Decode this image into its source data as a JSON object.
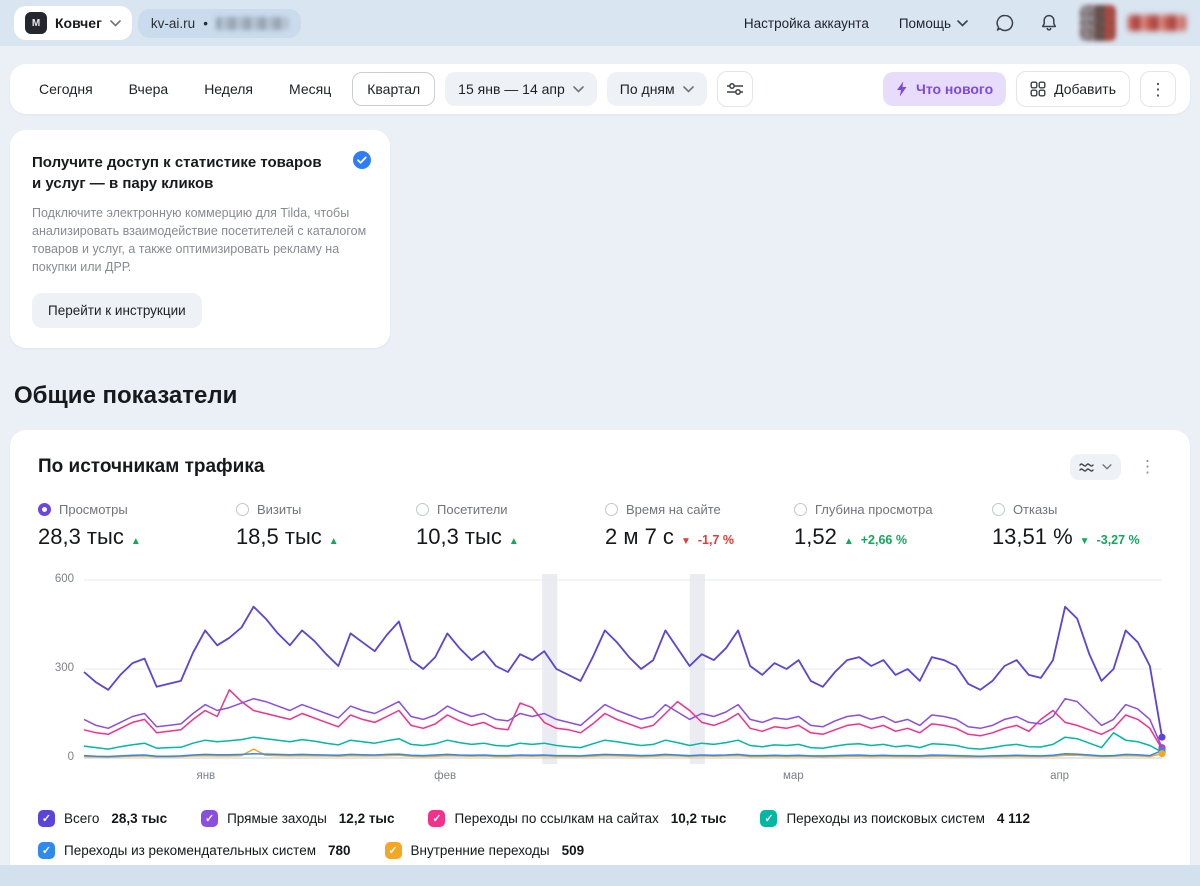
{
  "topbar": {
    "counter_name": "Ковчег",
    "site_domain": "kv-ai.ru",
    "separator": "•",
    "account_settings_label": "Настройка аккаунта",
    "help_label": "Помощь"
  },
  "toolbar": {
    "periods": [
      "Сегодня",
      "Вчера",
      "Неделя",
      "Месяц",
      "Квартал"
    ],
    "selected_period": "Квартал",
    "date_range_label": "15 янв — 14 апр",
    "granularity_label": "По дням",
    "whats_new_label": "Что нового",
    "add_label": "Добавить"
  },
  "promo": {
    "title": "Получите доступ к статистике товаров и услуг — в пару кликов",
    "body": "Подключите электронную коммерцию для Tilda, чтобы анализировать взаимодействие посетителей с каталогом товаров и услуг, а также оптимизировать рекламу на покупки или ДРР.",
    "button_label": "Перейти к инструкции"
  },
  "section_title": "Общие показатели",
  "chart_card": {
    "title": "По источникам трафика",
    "metrics": [
      {
        "label": "Просмотры",
        "value": "28,3 тыс",
        "arrow": "up",
        "arrow_color": "#14a75d",
        "delta": "",
        "delta_color": "",
        "selected": true
      },
      {
        "label": "Визиты",
        "value": "18,5 тыс",
        "arrow": "up",
        "arrow_color": "#14a75d",
        "delta": "",
        "delta_color": "",
        "selected": false
      },
      {
        "label": "Посетители",
        "value": "10,3 тыс",
        "arrow": "up",
        "arrow_color": "#14a75d",
        "delta": "",
        "delta_color": "",
        "selected": false
      },
      {
        "label": "Время на сайте",
        "value": "2 м 7 с",
        "arrow": "down",
        "arrow_color": "#e23b35",
        "delta": "-1,7 %",
        "delta_color": "#e23b35",
        "selected": false
      },
      {
        "label": "Глубина просмотра",
        "value": "1,52",
        "arrow": "up",
        "arrow_color": "#14a75d",
        "delta": "+2,66 %",
        "delta_color": "#14a75d",
        "selected": false
      },
      {
        "label": "Отказы",
        "value": "13,51 %",
        "arrow": "down",
        "arrow_color": "#14a75d",
        "delta": "-3,27 %",
        "delta_color": "#14a75d",
        "selected": false
      }
    ]
  },
  "chart_data": {
    "type": "line",
    "title": "По источникам трафика",
    "ylim": [
      0,
      600
    ],
    "yticks": [
      0,
      300,
      600
    ],
    "grid": true,
    "legend_position": "bottom",
    "xticks": [
      {
        "label": "янв",
        "frac": 0.113
      },
      {
        "label": "фев",
        "frac": 0.335
      },
      {
        "label": "мар",
        "frac": 0.658
      },
      {
        "label": "апр",
        "frac": 0.905
      }
    ],
    "bands": [
      {
        "frac": 0.425,
        "width_frac": 0.014
      },
      {
        "frac": 0.562,
        "width_frac": 0.014
      }
    ],
    "series": [
      {
        "name": "Всего",
        "total": "28,3 тыс",
        "color": "#5b44d8",
        "values": [
          290,
          255,
          230,
          280,
          320,
          335,
          240,
          250,
          260,
          355,
          430,
          380,
          405,
          440,
          510,
          470,
          420,
          380,
          430,
          395,
          350,
          310,
          420,
          390,
          360,
          415,
          460,
          330,
          300,
          340,
          420,
          370,
          330,
          360,
          310,
          290,
          350,
          330,
          360,
          300,
          280,
          260,
          340,
          430,
          390,
          340,
          300,
          330,
          430,
          370,
          310,
          350,
          330,
          370,
          430,
          310,
          280,
          320,
          300,
          330,
          260,
          240,
          290,
          330,
          340,
          310,
          330,
          280,
          300,
          260,
          340,
          330,
          310,
          250,
          230,
          260,
          310,
          330,
          280,
          270,
          330,
          510,
          470,
          350,
          260,
          300,
          430,
          390,
          310,
          70
        ]
      },
      {
        "name": "Прямые заходы",
        "total": "12,2 тыс",
        "color": "#8a4fe0",
        "values": [
          130,
          110,
          100,
          120,
          140,
          150,
          105,
          110,
          115,
          150,
          180,
          160,
          170,
          185,
          200,
          190,
          175,
          160,
          180,
          165,
          150,
          135,
          175,
          160,
          150,
          170,
          190,
          140,
          130,
          145,
          175,
          155,
          140,
          150,
          130,
          125,
          150,
          140,
          150,
          130,
          120,
          110,
          145,
          180,
          160,
          145,
          130,
          140,
          180,
          155,
          130,
          150,
          140,
          155,
          180,
          130,
          120,
          135,
          130,
          140,
          110,
          105,
          125,
          140,
          145,
          130,
          140,
          120,
          130,
          110,
          145,
          140,
          130,
          105,
          100,
          110,
          130,
          140,
          120,
          115,
          140,
          200,
          190,
          150,
          110,
          130,
          180,
          165,
          130,
          35
        ]
      },
      {
        "name": "Переходы по ссылкам на сайтах",
        "total": "10,2 тыс",
        "color": "#f2318c",
        "values": [
          95,
          85,
          80,
          100,
          120,
          130,
          85,
          90,
          95,
          130,
          160,
          140,
          230,
          190,
          160,
          150,
          140,
          130,
          150,
          135,
          120,
          105,
          145,
          130,
          120,
          140,
          160,
          110,
          100,
          115,
          145,
          125,
          110,
          120,
          100,
          95,
          185,
          170,
          120,
          100,
          95,
          85,
          115,
          150,
          130,
          115,
          100,
          110,
          150,
          190,
          160,
          120,
          110,
          125,
          150,
          100,
          90,
          105,
          100,
          110,
          85,
          80,
          95,
          110,
          115,
          100,
          110,
          90,
          100,
          85,
          115,
          110,
          100,
          80,
          75,
          85,
          100,
          110,
          90,
          130,
          160,
          120,
          110,
          95,
          80,
          100,
          145,
          130,
          100,
          30
        ]
      },
      {
        "name": "Переходы из поисковых систем",
        "total": "4 112",
        "color": "#00b7a4",
        "values": [
          40,
          35,
          30,
          38,
          45,
          50,
          33,
          35,
          36,
          50,
          60,
          55,
          58,
          62,
          70,
          65,
          60,
          55,
          62,
          57,
          50,
          44,
          60,
          55,
          50,
          58,
          65,
          46,
          42,
          48,
          60,
          52,
          46,
          50,
          42,
          40,
          50,
          46,
          50,
          42,
          38,
          35,
          48,
          60,
          55,
          48,
          42,
          46,
          60,
          52,
          42,
          50,
          46,
          52,
          60,
          42,
          38,
          44,
          42,
          46,
          35,
          33,
          40,
          46,
          48,
          42,
          46,
          38,
          42,
          35,
          48,
          46,
          42,
          33,
          30,
          35,
          42,
          46,
          38,
          37,
          46,
          70,
          65,
          50,
          35,
          85,
          60,
          55,
          42,
          20
        ]
      },
      {
        "name": "Переходы из рекомендательных систем",
        "total": "780",
        "color": "#2f8af0",
        "values": [
          8,
          6,
          5,
          7,
          9,
          10,
          6,
          6,
          7,
          10,
          12,
          11,
          11,
          12,
          14,
          13,
          12,
          11,
          12,
          11,
          10,
          9,
          12,
          11,
          10,
          12,
          13,
          9,
          8,
          10,
          12,
          10,
          9,
          10,
          8,
          8,
          10,
          9,
          10,
          8,
          8,
          7,
          10,
          12,
          11,
          10,
          8,
          9,
          12,
          10,
          8,
          10,
          9,
          10,
          12,
          8,
          8,
          9,
          8,
          9,
          7,
          7,
          8,
          9,
          10,
          8,
          9,
          8,
          8,
          7,
          10,
          9,
          8,
          7,
          6,
          7,
          8,
          9,
          8,
          7,
          9,
          14,
          13,
          10,
          7,
          8,
          12,
          11,
          8,
          25
        ]
      },
      {
        "name": "Внутренние переходы",
        "total": "509",
        "color": "#f5a623",
        "values": [
          5,
          4,
          3,
          5,
          6,
          7,
          4,
          4,
          5,
          7,
          8,
          7,
          7,
          8,
          30,
          9,
          8,
          7,
          8,
          7,
          7,
          6,
          8,
          7,
          7,
          8,
          9,
          6,
          5,
          6,
          8,
          7,
          6,
          7,
          5,
          5,
          7,
          6,
          7,
          5,
          5,
          5,
          6,
          8,
          7,
          6,
          5,
          6,
          8,
          7,
          5,
          7,
          6,
          7,
          8,
          5,
          5,
          6,
          5,
          6,
          5,
          4,
          5,
          6,
          6,
          5,
          6,
          5,
          5,
          5,
          6,
          6,
          5,
          4,
          4,
          5,
          5,
          6,
          5,
          5,
          6,
          9,
          9,
          7,
          5,
          6,
          8,
          7,
          5,
          15
        ]
      }
    ]
  }
}
